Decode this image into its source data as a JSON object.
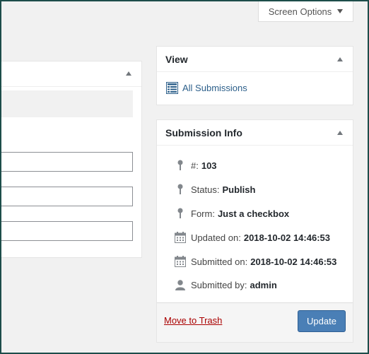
{
  "screen_options": {
    "label": "Screen Options"
  },
  "view_box": {
    "title": "View",
    "link_label": "All Submissions"
  },
  "info_box": {
    "title": "Submission Info",
    "rows": [
      {
        "label": "#:",
        "value": "103",
        "icon": "pin-icon"
      },
      {
        "label": "Status:",
        "value": "Publish",
        "icon": "pin-icon"
      },
      {
        "label": "Form:",
        "value": "Just a checkbox",
        "icon": "pin-icon"
      },
      {
        "label": "Updated on:",
        "value": "2018-10-02 14:46:53",
        "icon": "calendar-icon"
      },
      {
        "label": "Submitted on:",
        "value": "2018-10-02 14:46:53",
        "icon": "calendar-icon"
      },
      {
        "label": "Submitted by:",
        "value": "admin",
        "icon": "user-icon"
      }
    ],
    "trash_label": "Move to Trash",
    "update_label": "Update"
  },
  "colors": {
    "accent": "#4a7fb6",
    "link": "#2c5f8a",
    "danger": "#a00",
    "frame": "#1d4d4a"
  }
}
